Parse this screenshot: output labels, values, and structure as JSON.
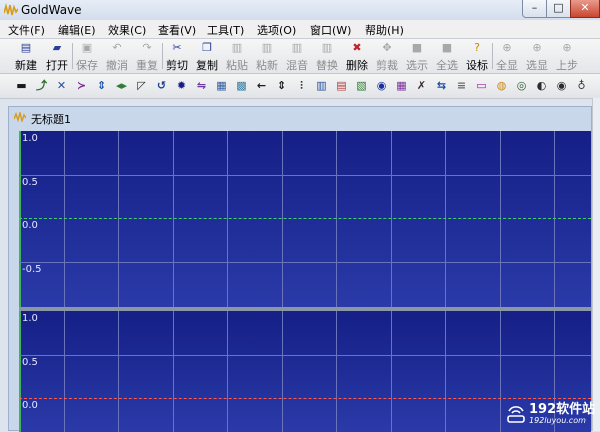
{
  "app": {
    "title": "GoldWave"
  },
  "window_buttons": {
    "minimize": "–",
    "maximize": "□",
    "close": "✕"
  },
  "menu": [
    "文件(F)",
    "编辑(E)",
    "效果(C)",
    "查看(V)",
    "工具(T)",
    "选项(O)",
    "窗口(W)",
    "帮助(H)"
  ],
  "toolbar": [
    {
      "label": "新建",
      "icon": "new-file-icon",
      "glyph": "▤",
      "enabled": true
    },
    {
      "label": "打开",
      "icon": "open-folder-icon",
      "glyph": "▰",
      "enabled": true
    },
    {
      "label": "保存",
      "icon": "save-icon",
      "glyph": "▣",
      "enabled": false
    },
    {
      "label": "撤消",
      "icon": "undo-icon",
      "glyph": "↶",
      "enabled": false
    },
    {
      "label": "重复",
      "icon": "redo-icon",
      "glyph": "↷",
      "enabled": false
    },
    {
      "label": "剪切",
      "icon": "scissors-icon",
      "glyph": "✂",
      "enabled": true
    },
    {
      "label": "复制",
      "icon": "copy-icon",
      "glyph": "❐",
      "enabled": true
    },
    {
      "label": "粘贴",
      "icon": "paste-icon",
      "glyph": "▥",
      "enabled": false
    },
    {
      "label": "粘新",
      "icon": "paste-new-icon",
      "glyph": "▥",
      "enabled": false
    },
    {
      "label": "混音",
      "icon": "mix-icon",
      "glyph": "▥",
      "enabled": false
    },
    {
      "label": "替换",
      "icon": "replace-icon",
      "glyph": "▥",
      "enabled": false
    },
    {
      "label": "删除",
      "icon": "delete-icon",
      "glyph": "✖",
      "enabled": true
    },
    {
      "label": "剪裁",
      "icon": "trim-icon",
      "glyph": "✥",
      "enabled": false
    },
    {
      "label": "选示",
      "icon": "select-view-icon",
      "glyph": "■",
      "enabled": false
    },
    {
      "label": "全选",
      "icon": "select-all-icon",
      "glyph": "■",
      "enabled": false
    },
    {
      "label": "设标",
      "icon": "set-marker-icon",
      "glyph": "?",
      "enabled": true
    },
    {
      "label": "全显",
      "icon": "show-all-icon",
      "glyph": "⊕",
      "enabled": false
    },
    {
      "label": "选显",
      "icon": "show-selection-icon",
      "glyph": "⊕",
      "enabled": false
    },
    {
      "label": "上步",
      "icon": "previous-zoom-icon",
      "glyph": "⊕",
      "enabled": false
    }
  ],
  "effects_toolbar": [
    {
      "icon": "dc-offset-icon",
      "glyph": "▬",
      "color": "#1a1a1a"
    },
    {
      "icon": "doppler-icon",
      "glyph": "⤴",
      "color": "#2b6d2b"
    },
    {
      "icon": "channel-swap-icon",
      "glyph": "✕",
      "color": "#234e9c"
    },
    {
      "icon": "echo-icon",
      "glyph": "≻",
      "color": "#7b2b8f"
    },
    {
      "icon": "compressor-icon",
      "glyph": "⇕",
      "color": "#1a56b0"
    },
    {
      "icon": "envelope-icon",
      "glyph": "◂▸",
      "color": "#2f7c3a"
    },
    {
      "icon": "fade-icon",
      "glyph": "◸",
      "color": "#2b2b2b"
    },
    {
      "icon": "loop-icon",
      "glyph": "↺",
      "color": "#1b3f8f"
    },
    {
      "icon": "mechanize-icon",
      "glyph": "✹",
      "color": "#1a1a8c"
    },
    {
      "icon": "pitch-icon",
      "glyph": "⇋",
      "color": "#6c3aa0"
    },
    {
      "icon": "equalizer-icon",
      "glyph": "▦",
      "color": "#2c5a9e"
    },
    {
      "icon": "filter-icon",
      "glyph": "▩",
      "color": "#3a7d9e"
    },
    {
      "icon": "arrow-left-icon",
      "glyph": "←",
      "color": "#1a1a1a"
    },
    {
      "icon": "time-warp-icon",
      "glyph": "⇕",
      "color": "#1a1a1a"
    },
    {
      "icon": "parametric-eq-icon",
      "glyph": "⫶",
      "color": "#1a1a1a"
    },
    {
      "icon": "volume-icon",
      "glyph": "▥",
      "color": "#204f9a"
    },
    {
      "icon": "mixer-icon",
      "glyph": "▤",
      "color": "#b53a3a"
    },
    {
      "icon": "noise-reduction-icon",
      "glyph": "▧",
      "color": "#2f7a2f"
    },
    {
      "icon": "spectrum-icon",
      "glyph": "◉",
      "color": "#1d2f9a"
    },
    {
      "icon": "stereo-icon",
      "glyph": "▦",
      "color": "#7c2b9a"
    },
    {
      "icon": "silence-icon",
      "glyph": "✗",
      "color": "#3a2b2b"
    },
    {
      "icon": "resample-icon",
      "glyph": "⇆",
      "color": "#1a48a0"
    },
    {
      "icon": "reverb-icon",
      "glyph": "≡",
      "color": "#6a6a6a"
    },
    {
      "icon": "bass-icon",
      "glyph": "▭",
      "color": "#9c1f9c"
    },
    {
      "icon": "balance-icon",
      "glyph": "◍",
      "color": "#c78a1a"
    },
    {
      "icon": "speed-icon",
      "glyph": "◎",
      "color": "#2c5b2c"
    },
    {
      "icon": "rewind-icon",
      "glyph": "◐",
      "color": "#2b2b2b"
    },
    {
      "icon": "search-icon",
      "glyph": "◉",
      "color": "#2b2b2b"
    },
    {
      "icon": "bulb-icon",
      "glyph": "♁",
      "color": "#3a3a3a"
    }
  ],
  "document": {
    "title": "无标题1"
  },
  "waveform": {
    "channel1_labels": [
      "1.0",
      "0.5",
      "0.0",
      "-0.5"
    ],
    "channel2_labels": [
      "1.0",
      "0.5",
      "0.0"
    ],
    "channel1_line_color": "#3fd06a",
    "channel2_line_color": "#ff5a4a",
    "background_color": "#1f2a8e"
  },
  "watermark": {
    "line1": "192软件站",
    "line2": "192luyou.com"
  }
}
